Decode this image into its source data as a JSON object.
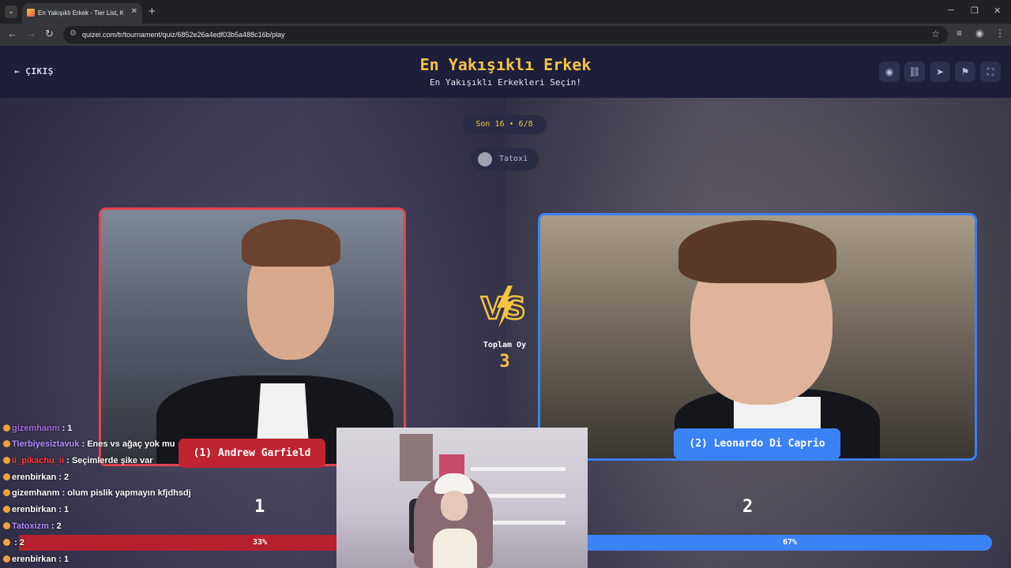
{
  "browser": {
    "tab_title": "En Yakışıklı Erkek - Tier List, Kor",
    "url": "quizei.com/tr/tournament/quiz/6852e26a4edf03b5a488c16b/play"
  },
  "header": {
    "exit_label": "ÇIKIŞ",
    "title": "En Yakışıklı Erkek",
    "subtitle": "En Yakışıklı Erkekleri Seçin!"
  },
  "arena": {
    "round_label": "Son 16 • 6/8",
    "creator": "Tatoxi",
    "total_votes_label": "Toplam Oy",
    "total_votes": "3"
  },
  "contestants": [
    {
      "label": "(1) Andrew Garfield",
      "votes": "1",
      "percent_text": "33%",
      "percent": 33
    },
    {
      "label": "(2) Leonardo Di Caprio",
      "votes": "2",
      "percent_text": "67%",
      "percent": 67
    }
  ],
  "chat": [
    {
      "user": "gizemhanm",
      "msg": ": 1",
      "color": "#a46de0"
    },
    {
      "user": "Tierbiyesiztavuk",
      "msg": ": Enes vs ağaç yok mu",
      "color": "#b28cff"
    },
    {
      "user": "ii_pikachu_ii",
      "msg": ": Seçimlerde şike var",
      "color": "#ff3b3b"
    },
    {
      "user": "erenbirkan",
      "msg": ": 2",
      "color": "#ffffff"
    },
    {
      "user": "gizemhanm",
      "msg": ": olum pislik yapmayın kfjdhsdj",
      "color": "#ffffff"
    },
    {
      "user": "erenbirkan",
      "msg": ": 1",
      "color": "#ffffff"
    },
    {
      "user": "Tatoxizm",
      "msg": ": 2",
      "color": "#b28cff"
    },
    {
      "user": "",
      "msg": ": 2",
      "color": "#ffffff"
    },
    {
      "user": "erenbirkan",
      "msg": ": 1",
      "color": "#ffffff"
    }
  ],
  "colors": {
    "accent_yellow": "#f4c542",
    "left_red": "#e2434f",
    "right_blue": "#3b82f6"
  }
}
